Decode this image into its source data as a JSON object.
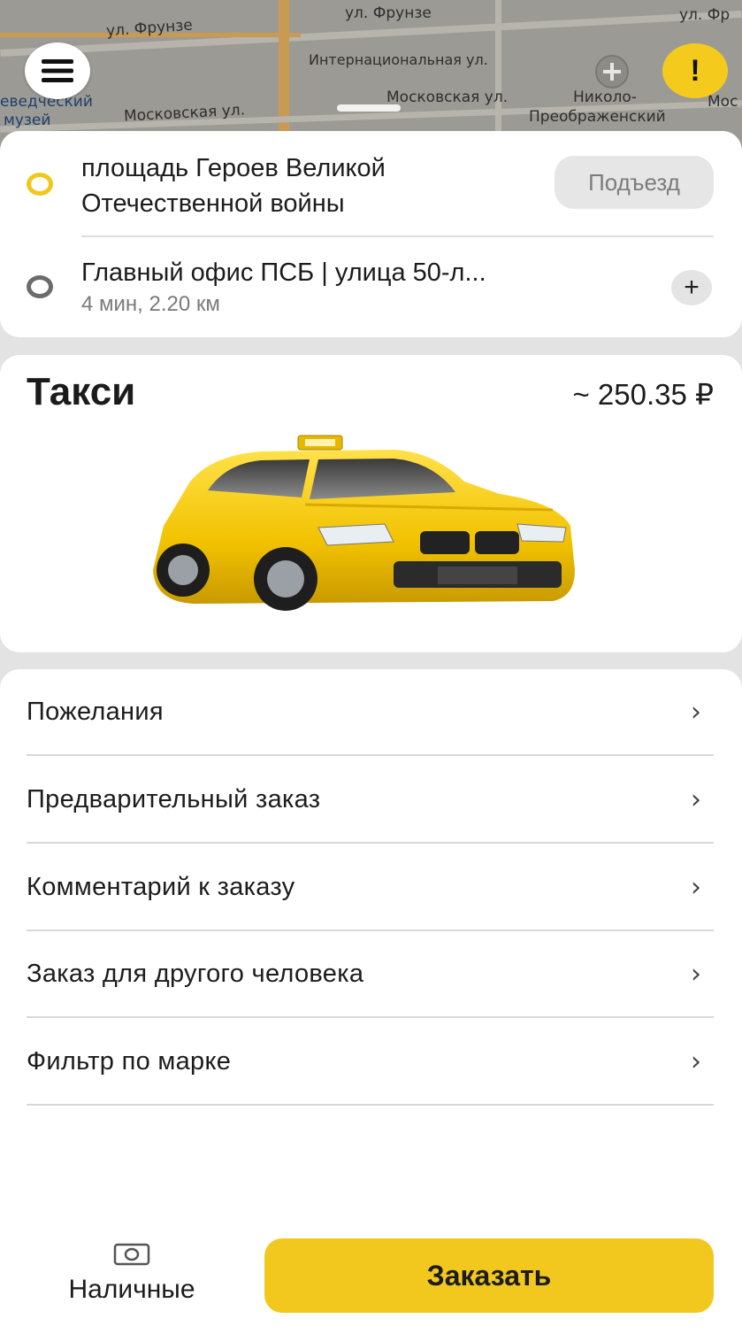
{
  "map": {
    "streets": [
      "ул. Фрунзе",
      "ул. Фрунзе",
      "ул. Фр",
      "Интернациональная ул.",
      "Московская ул.",
      "Московская ул.",
      "Николо-",
      "Преображенский",
      "еведческий",
      "музей",
      "Мос"
    ]
  },
  "route": {
    "from": "площадь Героев Великой Отечественной войны",
    "entrance_button": "Подъезд",
    "to": "Главный офис ПСБ  | улица 50-л...",
    "to_meta": "4 мин, 2.20 км",
    "add_stop_icon": "plus-icon"
  },
  "tariff": {
    "name": "Такси",
    "price": "~ 250.35 ₽"
  },
  "options": [
    {
      "label": "Пожелания"
    },
    {
      "label": "Предварительный заказ"
    },
    {
      "label": "Комментарий к заказу"
    },
    {
      "label": "Заказ для другого человека"
    },
    {
      "label": "Фильтр по марке"
    }
  ],
  "payment": {
    "label": "Наличные",
    "icon": "cash-icon"
  },
  "order_button": "Заказать",
  "colors": {
    "accent": "#f2c81e",
    "from_dot": "#f0c81c",
    "to_dot": "#6b6b6b"
  }
}
